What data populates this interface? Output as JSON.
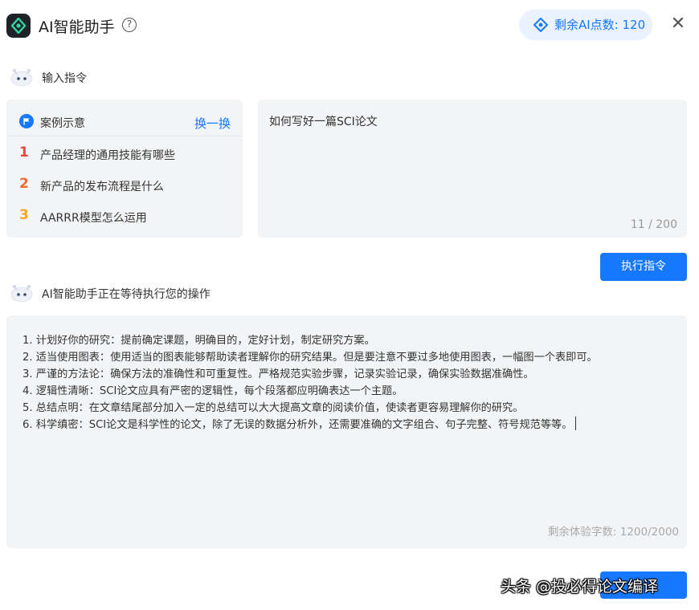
{
  "header": {
    "title": "AI智能助手",
    "help_glyph": "?",
    "points_label": "剩余AI点数: 120",
    "close_glyph": "✕"
  },
  "input_section": {
    "label": "输入指令"
  },
  "examples": {
    "title": "案例示意",
    "swap_label": "换一换",
    "items": [
      {
        "num": "1",
        "text": "产品经理的通用技能有哪些",
        "color": "#e8483c"
      },
      {
        "num": "2",
        "text": "新产品的发布流程是什么",
        "color": "#f26b2b"
      },
      {
        "num": "3",
        "text": "AARRR模型怎么运用",
        "color": "#f5a623"
      }
    ]
  },
  "prompt": {
    "value": "如何写好一篇SCI论文",
    "count": "11 / 200"
  },
  "execute_button": {
    "label": "执行指令"
  },
  "status_section": {
    "label": "AI智能助手正在等待执行您的操作"
  },
  "result": {
    "lines": [
      "1. 计划好你的研究：提前确定课题，明确目的，定好计划，制定研究方案。",
      "2. 适当使用图表：使用适当的图表能够帮助读者理解你的研究结果。但是要注意不要过多地使用图表，一幅图一个表即可。",
      "3. 严谨的方法论：确保方法的准确性和可重复性。严格规范实验步骤，记录实验记录，确保实验数据准确性。",
      "4. 逻辑性清晰：SCI论文应具有严密的逻辑性，每个段落都应明确表达一个主题。",
      "5. 总结点明：在文章结尾部分加入一定的总结可以大大提高文章的阅读价值，使读者更容易理解你的研究。",
      "6. 科学缜密：SCI论文是科学性的论文，除了无误的数据分析外，还需要准确的文字组合、句子完整、符号规范等等。"
    ],
    "remaining": "剩余体验字数: 1200/2000"
  },
  "watermark": "头条 @投必得论文编译",
  "colors": {
    "accent": "#1677ff",
    "panel": "#f3f4f6"
  }
}
